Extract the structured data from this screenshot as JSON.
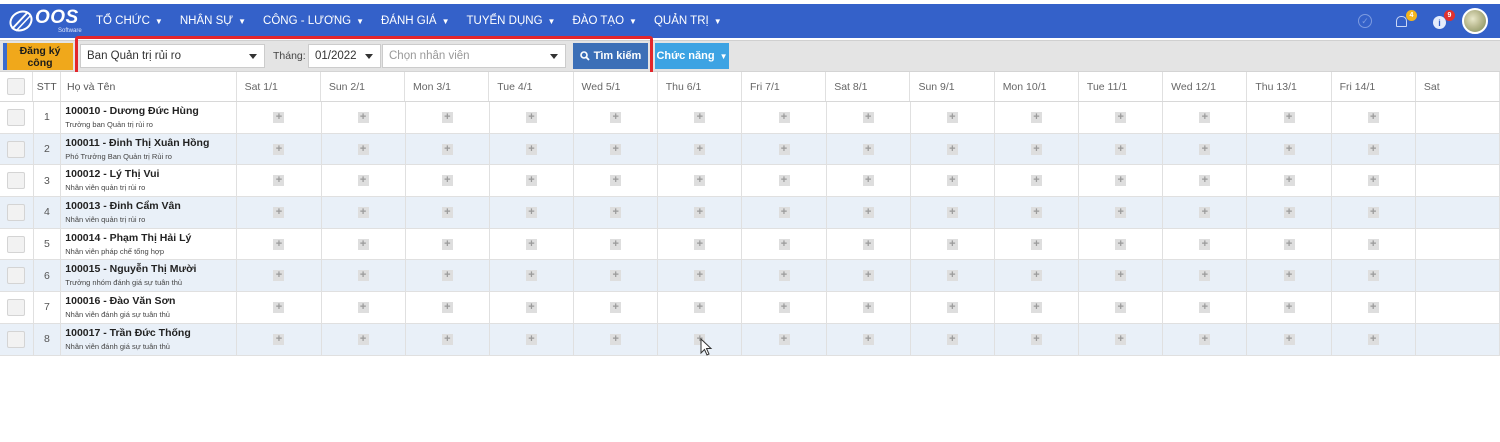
{
  "brand": {
    "name": "OOS",
    "sub": "Software"
  },
  "nav": [
    {
      "label": "TỔ CHỨC"
    },
    {
      "label": "NHÂN SỰ"
    },
    {
      "label": "CÔNG - LƯƠNG"
    },
    {
      "label": "ĐÁNH GIÁ"
    },
    {
      "label": "TUYỂN DỤNG"
    },
    {
      "label": "ĐÀO TẠO"
    },
    {
      "label": "QUẢN TRỊ"
    }
  ],
  "notifications": {
    "bell_count": "4",
    "info_count": "9"
  },
  "toolbar": {
    "register_label": "Đăng ký công",
    "department_value": "Ban Quản trị rủi ro",
    "month_label": "Tháng:",
    "month_value": "01/2022",
    "employee_placeholder": "Chọn nhân viên",
    "search_label": "Tìm kiếm",
    "function_label": "Chức năng"
  },
  "table": {
    "col_stt": "STT",
    "col_name": "Họ và Tên",
    "days": [
      "Sat 1/1",
      "Sun 2/1",
      "Mon 3/1",
      "Tue 4/1",
      "Wed 5/1",
      "Thu 6/1",
      "Fri 7/1",
      "Sat 8/1",
      "Sun 9/1",
      "Mon 10/1",
      "Tue 11/1",
      "Wed 12/1",
      "Thu 13/1",
      "Fri 14/1",
      "Sat"
    ],
    "rows": [
      {
        "stt": "1",
        "name": "100010 - Dương Đức Hùng",
        "position": "Trưởng ban Quản trị rủi ro"
      },
      {
        "stt": "2",
        "name": "100011 - Đinh Thị Xuân Hồng",
        "position": "Phó Trưởng Ban Quản trị Rủi ro"
      },
      {
        "stt": "3",
        "name": "100012 - Lý Thị Vui",
        "position": "Nhân viên quản trị rủi ro"
      },
      {
        "stt": "4",
        "name": "100013 - Đinh Cẩm Vân",
        "position": "Nhân viên quản trị rủi ro"
      },
      {
        "stt": "5",
        "name": "100014 - Phạm Thị Hải Lý",
        "position": "Nhân viên pháp chế tổng hợp"
      },
      {
        "stt": "6",
        "name": "100015 - Nguyễn Thị Mười",
        "position": "Trưởng nhóm đánh giá sự tuân thủ"
      },
      {
        "stt": "7",
        "name": "100016 - Đào Văn Sơn",
        "position": "Nhân viên đánh giá sự tuân thủ"
      },
      {
        "stt": "8",
        "name": "100017 - Trần Đức Thống",
        "position": "Nhân viên đánh giá sự tuân thủ"
      }
    ],
    "cell_symbol": "+"
  },
  "colors": {
    "topbar": "#3461c9",
    "highlight": "#e3262b",
    "register_button": "#f0a81b",
    "search_button": "#3c6fb7",
    "function_button": "#3da3e3",
    "alt_row": "#e9f0f8"
  }
}
